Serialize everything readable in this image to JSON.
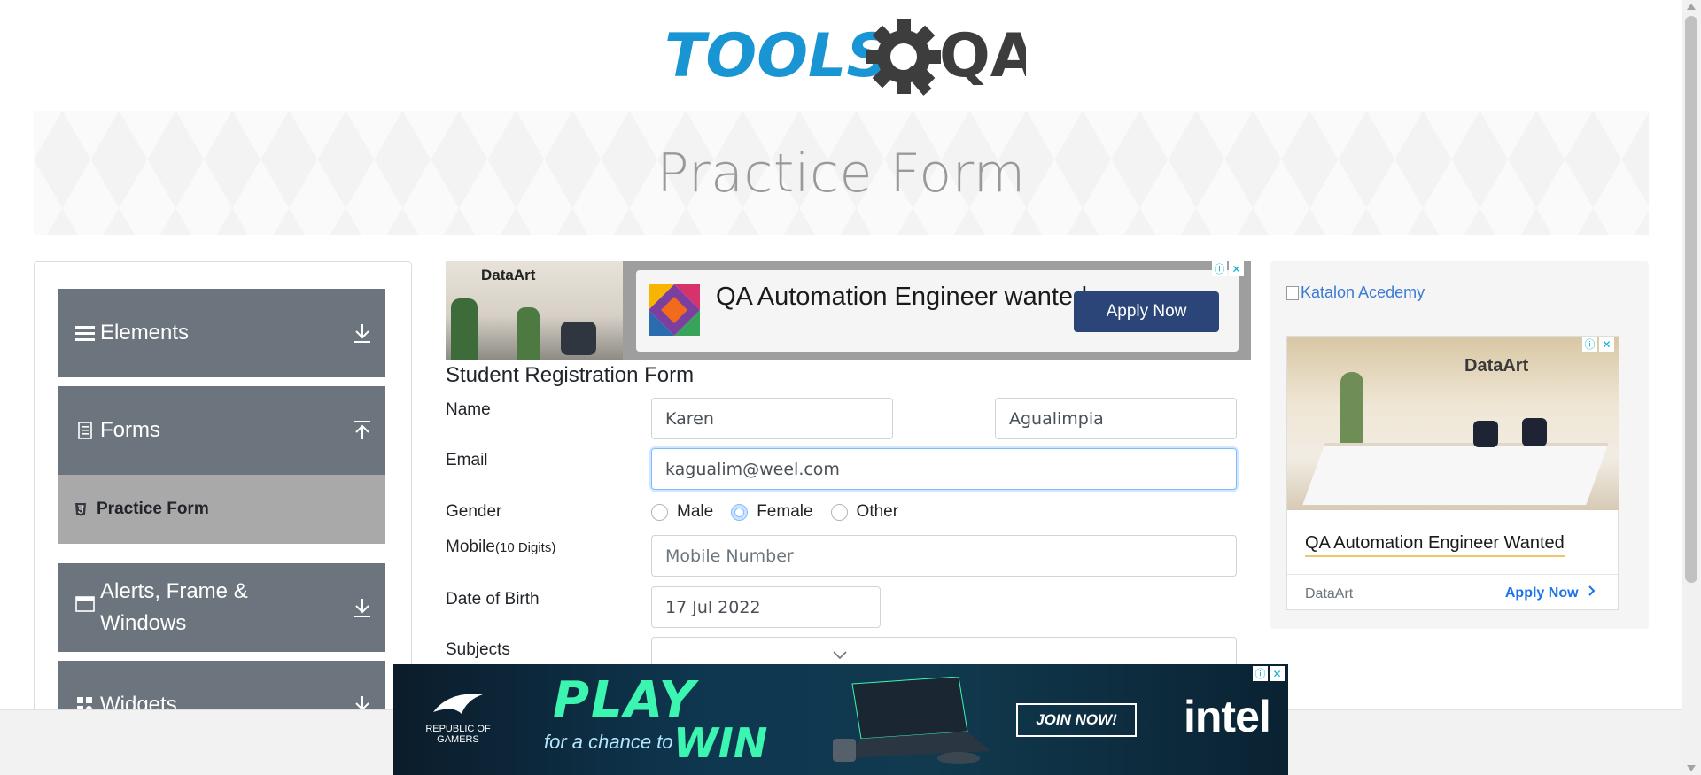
{
  "header": {
    "logo_text_left": "TOOLS",
    "logo_text_right": "QA",
    "page_title": "Practice Form"
  },
  "sidebar": {
    "groups": [
      {
        "label": "Elements",
        "icon": "hamburger-icon",
        "state": "collapsed"
      },
      {
        "label": "Forms",
        "icon": "document-icon",
        "state": "expanded",
        "items": [
          {
            "label": "Practice Form",
            "icon": "html5-icon",
            "active": true
          }
        ]
      },
      {
        "label": "Alerts, Frame & Windows",
        "icon": "window-icon",
        "state": "collapsed"
      },
      {
        "label": "Widgets",
        "icon": "widgets-icon",
        "state": "collapsed"
      }
    ]
  },
  "ad_top": {
    "brand": "DataArt",
    "headline": "QA Automation Engineer wanted",
    "button": "Apply Now",
    "info_icon": "ⓘ",
    "close_icon": "✕"
  },
  "form": {
    "title": "Student Registration Form",
    "name_label": "Name",
    "first_name": "Karen",
    "last_name": "Agualimpia",
    "email_label": "Email",
    "email": "kagualim@weel.com",
    "gender_label": "Gender",
    "gender_options": [
      "Male",
      "Female",
      "Other"
    ],
    "gender_selected": "Female",
    "mobile_label": "Mobile",
    "mobile_hint": "(10 Digits)",
    "mobile_placeholder": "Mobile Number",
    "dob_label": "Date of Birth",
    "dob": "17 Jul 2022",
    "subjects_label": "Subjects"
  },
  "ad_right": {
    "link": "Katalon Acedemy",
    "brand": "DataArt",
    "title": "QA Automation Engineer Wanted",
    "source": "DataArt",
    "apply": "Apply Now",
    "info_icon": "ⓘ",
    "close_icon": "✕"
  },
  "ad_bottom": {
    "rog": "REPUBLIC OF GAMERS",
    "play": "PLAY",
    "chance": "for a chance to",
    "win": "WIN",
    "join": "JOIN NOW!",
    "intel": "intel",
    "info_icon": "ⓘ",
    "close_icon": "✕"
  },
  "colors": {
    "brand_blue": "#1a95d3",
    "brand_dark": "#3d3d3d",
    "sidebar_gray": "#6c757d",
    "active_item": "#a9a9a9",
    "focus_border": "#80bdff"
  }
}
